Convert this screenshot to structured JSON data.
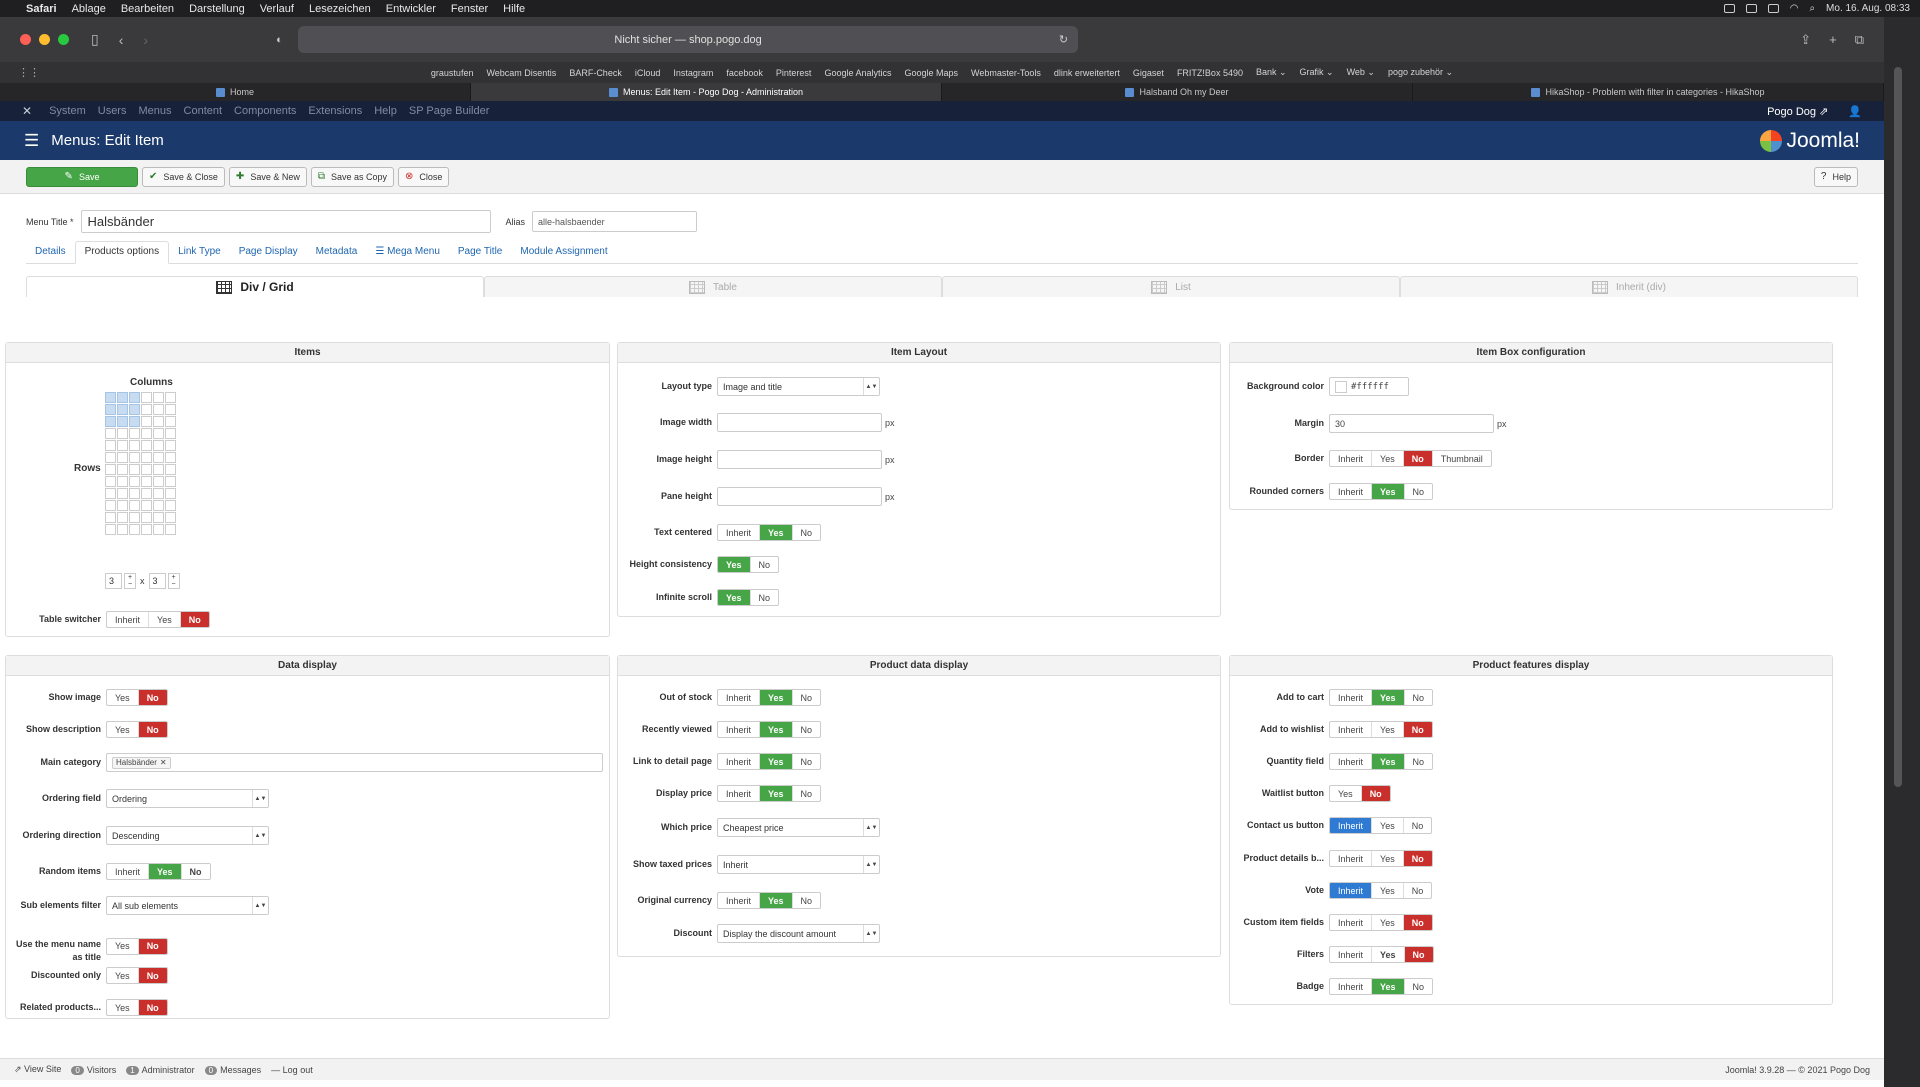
{
  "menubar": {
    "app": "Safari",
    "items": [
      "Ablage",
      "Bearbeiten",
      "Darstellung",
      "Verlauf",
      "Lesezeichen",
      "Entwickler",
      "Fenster",
      "Hilfe"
    ],
    "clock": "Mo. 16. Aug.  08:33"
  },
  "browser": {
    "url": "Nicht sicher — shop.pogo.dog",
    "favorites": [
      "graustufen",
      "Webcam Disentis",
      "BARF-Check",
      "iCloud",
      "Instagram",
      "facebook",
      "Pinterest",
      "Google Analytics",
      "Google Maps",
      "Webmaster-Tools",
      "dlink erweitertert",
      "Gigaset",
      "FRITZ!Box 5490",
      "Bank ⌄",
      "Grafik ⌄",
      "Web ⌄",
      "pogo zubehör ⌄"
    ],
    "tabs": [
      "Home",
      "Menus: Edit Item - Pogo Dog - Administration",
      "Halsband Oh my Deer",
      "HikaShop - Problem with filter in categories - HikaShop"
    ]
  },
  "jnav": {
    "items": [
      "System",
      "Users",
      "Menus",
      "Content",
      "Components",
      "Extensions",
      "Help",
      "SP Page Builder"
    ],
    "site": "Pogo Dog ⇗"
  },
  "header": {
    "title": "Menus: Edit Item",
    "logo": "Joomla!"
  },
  "toolbar": {
    "save": "Save",
    "save_close": "Save & Close",
    "save_new": "Save & New",
    "save_copy": "Save as Copy",
    "close": "Close",
    "help": "Help"
  },
  "form": {
    "title_label": "Menu Title *",
    "title_value": "Halsbänder",
    "alias_label": "Alias",
    "alias_value": "alle-halsbaender"
  },
  "tabs": [
    "Details",
    "Products options",
    "Link Type",
    "Page Display",
    "Metadata",
    "Mega Menu",
    "Page Title",
    "Module Assignment"
  ],
  "layout_tabs": [
    "Div / Grid",
    "Table",
    "List",
    "Inherit (div)"
  ],
  "items_box": {
    "title": "Items",
    "columns": "Columns",
    "rows": "Rows",
    "cols_val": "3",
    "rows_val": "3",
    "x": "x",
    "table_switcher": "Table switcher"
  },
  "item_layout": {
    "title": "Item Layout",
    "layout_type": "Layout type",
    "layout_value": "Image and title",
    "image_width": "Image width",
    "image_height": "Image height",
    "pane_height": "Pane height",
    "px": "px",
    "text_centered": "Text centered",
    "height_consistency": "Height consistency",
    "infinite_scroll": "Infinite scroll"
  },
  "item_box": {
    "title": "Item Box configuration",
    "bg_color": "Background color",
    "bg_value": "#ffffff",
    "margin": "Margin",
    "margin_value": "30",
    "border": "Border",
    "rounded": "Rounded corners",
    "thumbnail": "Thumbnail"
  },
  "data_display": {
    "title": "Data display",
    "show_image": "Show image",
    "show_description": "Show description",
    "main_category": "Main category",
    "category_tag": "Halsbänder",
    "ordering_field": "Ordering field",
    "ordering_value": "Ordering",
    "ordering_direction": "Ordering direction",
    "direction_value": "Descending",
    "random_items": "Random items",
    "sub_filter": "Sub elements filter",
    "sub_value": "All sub elements",
    "menu_name_title": "Use the menu name as title",
    "discounted_only": "Discounted only",
    "related": "Related products..."
  },
  "product_data": {
    "title": "Product data display",
    "out_of_stock": "Out of stock",
    "recently_viewed": "Recently viewed",
    "link_detail": "Link to detail page",
    "display_price": "Display price",
    "which_price": "Which price",
    "which_value": "Cheapest price",
    "taxed": "Show taxed prices",
    "taxed_value": "Inherit",
    "original_currency": "Original currency",
    "discount": "Discount",
    "discount_value": "Display the discount amount"
  },
  "features": {
    "title": "Product features display",
    "add_to_cart": "Add to cart",
    "add_to_wishlist": "Add to wishlist",
    "quantity": "Quantity field",
    "waitlist": "Waitlist button",
    "contact": "Contact us button",
    "product_details": "Product details b...",
    "vote": "Vote",
    "custom_fields": "Custom item fields",
    "filters": "Filters",
    "badge": "Badge"
  },
  "toggle": {
    "inherit": "Inherit",
    "yes": "Yes",
    "no": "No"
  },
  "status": {
    "view_site": "View Site",
    "visitors_count": "0",
    "visitors": "Visitors",
    "admin_count": "1",
    "admin": "Administrator",
    "messages_count": "0",
    "messages": "Messages",
    "logout": "Log out",
    "version": "Joomla! 3.9.28  —  © 2021 Pogo Dog"
  }
}
